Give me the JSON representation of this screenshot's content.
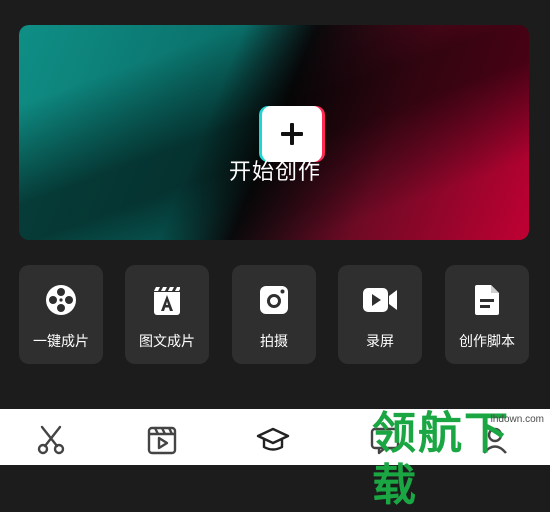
{
  "hero": {
    "title": "开始创作",
    "add_icon": "plus-icon",
    "colors": {
      "teal": "#0f8f86",
      "red": "#c00033",
      "fringe_cyan": "#1fd6d0",
      "fringe_red": "#ff2a56"
    }
  },
  "tools": [
    {
      "label": "一键成片",
      "icon": "film-reel-icon"
    },
    {
      "label": "图文成片",
      "icon": "clapperboard-text-icon"
    },
    {
      "label": "拍摄",
      "icon": "camera-icon"
    },
    {
      "label": "录屏",
      "icon": "video-camera-icon"
    },
    {
      "label": "创作脚本",
      "icon": "document-icon"
    }
  ],
  "bottom_nav": [
    {
      "icon": "scissors-icon"
    },
    {
      "icon": "video-template-icon"
    },
    {
      "icon": "graduation-cap-icon"
    },
    {
      "icon": "message-icon"
    },
    {
      "icon": "profile-icon"
    }
  ],
  "watermark": {
    "text": "领航下载",
    "url": "lhdown.com"
  }
}
